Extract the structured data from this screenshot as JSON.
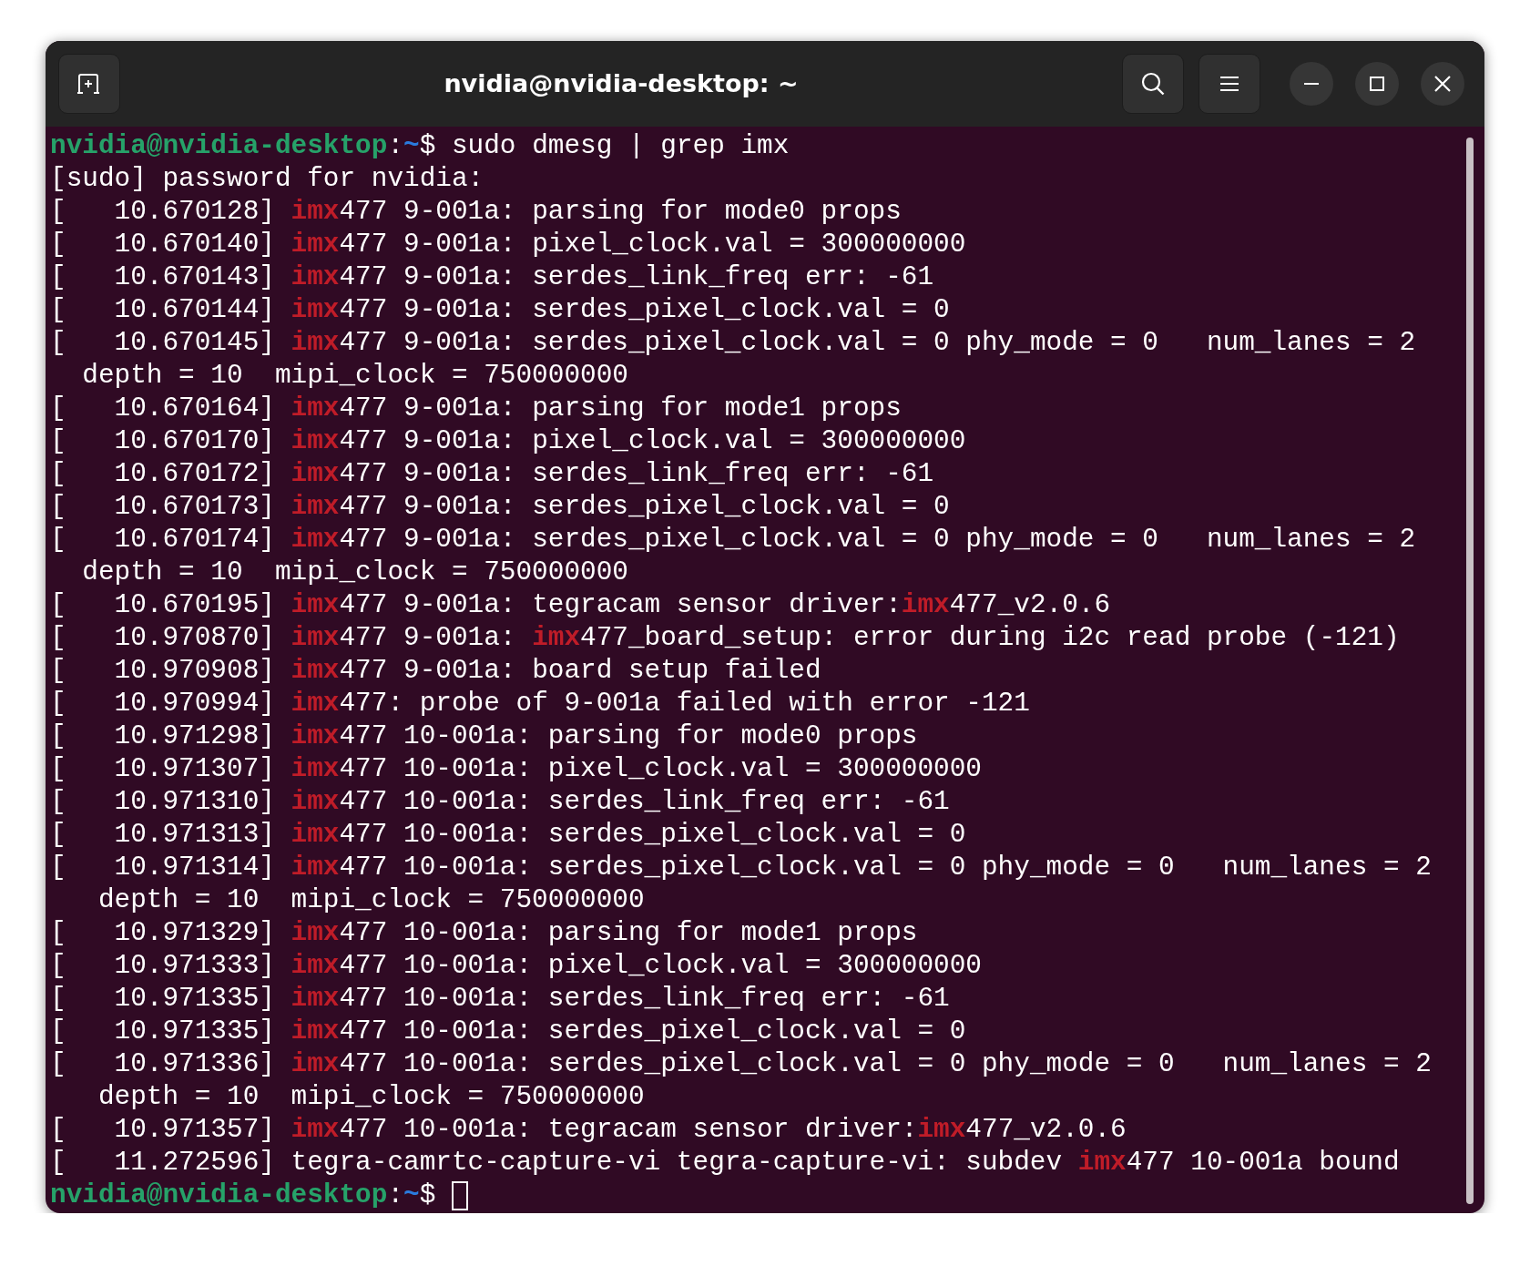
{
  "window": {
    "title": "nvidia@nvidia-desktop: ~"
  },
  "terminal": {
    "cursor_visible": true,
    "lines": [
      [
        {
          "text": "nvidia@nvidia-desktop",
          "kind": "user"
        },
        {
          "text": ":",
          "kind": "plain"
        },
        {
          "text": "~",
          "kind": "path"
        },
        {
          "text": "$ sudo dmesg | grep imx",
          "kind": "plain"
        }
      ],
      [
        {
          "text": "[sudo] password for nvidia:",
          "kind": "plain"
        }
      ],
      [
        {
          "text": "[   10.670128] ",
          "kind": "plain"
        },
        {
          "text": "imx",
          "kind": "match"
        },
        {
          "text": "477 9-001a: parsing for mode0 props",
          "kind": "plain"
        }
      ],
      [
        {
          "text": "[   10.670140] ",
          "kind": "plain"
        },
        {
          "text": "imx",
          "kind": "match"
        },
        {
          "text": "477 9-001a: pixel_clock.val = 300000000",
          "kind": "plain"
        }
      ],
      [
        {
          "text": "[   10.670143] ",
          "kind": "plain"
        },
        {
          "text": "imx",
          "kind": "match"
        },
        {
          "text": "477 9-001a: serdes_link_freq err: -61",
          "kind": "plain"
        }
      ],
      [
        {
          "text": "[   10.670144] ",
          "kind": "plain"
        },
        {
          "text": "imx",
          "kind": "match"
        },
        {
          "text": "477 9-001a: serdes_pixel_clock.val = 0",
          "kind": "plain"
        }
      ],
      [
        {
          "text": "[   10.670145] ",
          "kind": "plain"
        },
        {
          "text": "imx",
          "kind": "match"
        },
        {
          "text": "477 9-001a: serdes_pixel_clock.val = 0 phy_mode = 0   num_lanes = 2",
          "kind": "plain"
        }
      ],
      [
        {
          "text": "  depth = 10  mipi_clock = 750000000",
          "kind": "plain"
        }
      ],
      [
        {
          "text": "[   10.670164] ",
          "kind": "plain"
        },
        {
          "text": "imx",
          "kind": "match"
        },
        {
          "text": "477 9-001a: parsing for mode1 props",
          "kind": "plain"
        }
      ],
      [
        {
          "text": "[   10.670170] ",
          "kind": "plain"
        },
        {
          "text": "imx",
          "kind": "match"
        },
        {
          "text": "477 9-001a: pixel_clock.val = 300000000",
          "kind": "plain"
        }
      ],
      [
        {
          "text": "[   10.670172] ",
          "kind": "plain"
        },
        {
          "text": "imx",
          "kind": "match"
        },
        {
          "text": "477 9-001a: serdes_link_freq err: -61",
          "kind": "plain"
        }
      ],
      [
        {
          "text": "[   10.670173] ",
          "kind": "plain"
        },
        {
          "text": "imx",
          "kind": "match"
        },
        {
          "text": "477 9-001a: serdes_pixel_clock.val = 0",
          "kind": "plain"
        }
      ],
      [
        {
          "text": "[   10.670174] ",
          "kind": "plain"
        },
        {
          "text": "imx",
          "kind": "match"
        },
        {
          "text": "477 9-001a: serdes_pixel_clock.val = 0 phy_mode = 0   num_lanes = 2",
          "kind": "plain"
        }
      ],
      [
        {
          "text": "  depth = 10  mipi_clock = 750000000",
          "kind": "plain"
        }
      ],
      [
        {
          "text": "[   10.670195] ",
          "kind": "plain"
        },
        {
          "text": "imx",
          "kind": "match"
        },
        {
          "text": "477 9-001a: tegracam sensor driver:",
          "kind": "plain"
        },
        {
          "text": "imx",
          "kind": "match"
        },
        {
          "text": "477_v2.0.6",
          "kind": "plain"
        }
      ],
      [
        {
          "text": "[   10.970870] ",
          "kind": "plain"
        },
        {
          "text": "imx",
          "kind": "match"
        },
        {
          "text": "477 9-001a: ",
          "kind": "plain"
        },
        {
          "text": "imx",
          "kind": "match"
        },
        {
          "text": "477_board_setup: error during i2c read probe (-121)",
          "kind": "plain"
        }
      ],
      [
        {
          "text": "[   10.970908] ",
          "kind": "plain"
        },
        {
          "text": "imx",
          "kind": "match"
        },
        {
          "text": "477 9-001a: board setup failed",
          "kind": "plain"
        }
      ],
      [
        {
          "text": "[   10.970994] ",
          "kind": "plain"
        },
        {
          "text": "imx",
          "kind": "match"
        },
        {
          "text": "477: probe of 9-001a failed with error -121",
          "kind": "plain"
        }
      ],
      [
        {
          "text": "[   10.971298] ",
          "kind": "plain"
        },
        {
          "text": "imx",
          "kind": "match"
        },
        {
          "text": "477 10-001a: parsing for mode0 props",
          "kind": "plain"
        }
      ],
      [
        {
          "text": "[   10.971307] ",
          "kind": "plain"
        },
        {
          "text": "imx",
          "kind": "match"
        },
        {
          "text": "477 10-001a: pixel_clock.val = 300000000",
          "kind": "plain"
        }
      ],
      [
        {
          "text": "[   10.971310] ",
          "kind": "plain"
        },
        {
          "text": "imx",
          "kind": "match"
        },
        {
          "text": "477 10-001a: serdes_link_freq err: -61",
          "kind": "plain"
        }
      ],
      [
        {
          "text": "[   10.971313] ",
          "kind": "plain"
        },
        {
          "text": "imx",
          "kind": "match"
        },
        {
          "text": "477 10-001a: serdes_pixel_clock.val = 0",
          "kind": "plain"
        }
      ],
      [
        {
          "text": "[   10.971314] ",
          "kind": "plain"
        },
        {
          "text": "imx",
          "kind": "match"
        },
        {
          "text": "477 10-001a: serdes_pixel_clock.val = 0 phy_mode = 0   num_lanes = 2",
          "kind": "plain"
        }
      ],
      [
        {
          "text": "   depth = 10  mipi_clock = 750000000",
          "kind": "plain"
        }
      ],
      [
        {
          "text": "[   10.971329] ",
          "kind": "plain"
        },
        {
          "text": "imx",
          "kind": "match"
        },
        {
          "text": "477 10-001a: parsing for mode1 props",
          "kind": "plain"
        }
      ],
      [
        {
          "text": "[   10.971333] ",
          "kind": "plain"
        },
        {
          "text": "imx",
          "kind": "match"
        },
        {
          "text": "477 10-001a: pixel_clock.val = 300000000",
          "kind": "plain"
        }
      ],
      [
        {
          "text": "[   10.971335] ",
          "kind": "plain"
        },
        {
          "text": "imx",
          "kind": "match"
        },
        {
          "text": "477 10-001a: serdes_link_freq err: -61",
          "kind": "plain"
        }
      ],
      [
        {
          "text": "[   10.971335] ",
          "kind": "plain"
        },
        {
          "text": "imx",
          "kind": "match"
        },
        {
          "text": "477 10-001a: serdes_pixel_clock.val = 0",
          "kind": "plain"
        }
      ],
      [
        {
          "text": "[   10.971336] ",
          "kind": "plain"
        },
        {
          "text": "imx",
          "kind": "match"
        },
        {
          "text": "477 10-001a: serdes_pixel_clock.val = 0 phy_mode = 0   num_lanes = 2",
          "kind": "plain"
        }
      ],
      [
        {
          "text": "   depth = 10  mipi_clock = 750000000",
          "kind": "plain"
        }
      ],
      [
        {
          "text": "[   10.971357] ",
          "kind": "plain"
        },
        {
          "text": "imx",
          "kind": "match"
        },
        {
          "text": "477 10-001a: tegracam sensor driver:",
          "kind": "plain"
        },
        {
          "text": "imx",
          "kind": "match"
        },
        {
          "text": "477_v2.0.6",
          "kind": "plain"
        }
      ],
      [
        {
          "text": "[   11.272596] tegra-camrtc-capture-vi tegra-capture-vi: subdev ",
          "kind": "plain"
        },
        {
          "text": "imx",
          "kind": "match"
        },
        {
          "text": "477 10-001a bound",
          "kind": "plain"
        }
      ],
      [
        {
          "text": "nvidia@nvidia-desktop",
          "kind": "user"
        },
        {
          "text": ":",
          "kind": "plain"
        },
        {
          "text": "~",
          "kind": "path"
        },
        {
          "text": "$ ",
          "kind": "plain"
        }
      ]
    ]
  }
}
